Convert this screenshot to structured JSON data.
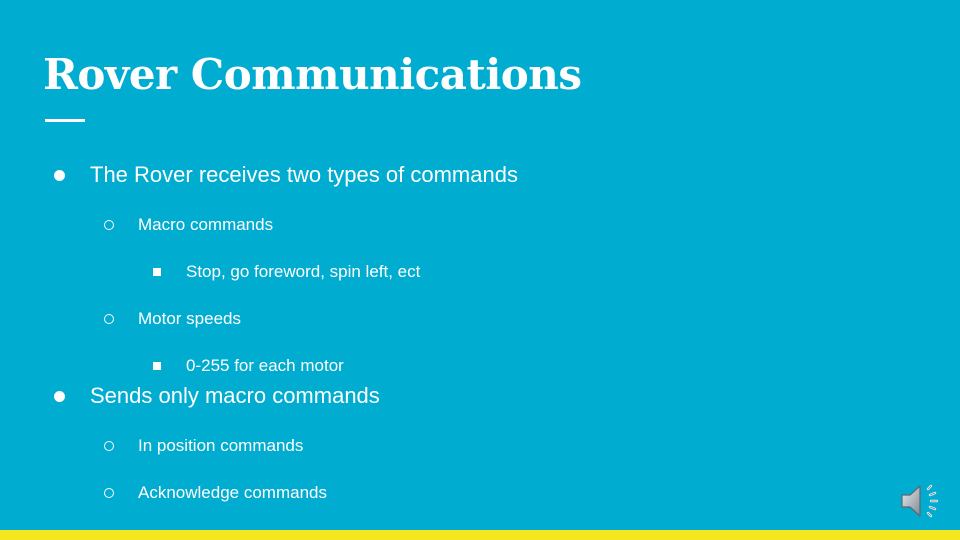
{
  "slide": {
    "title": "Rover Communications",
    "bullets": {
      "b1": "The Rover receives two types of commands",
      "b1_1": "Macro commands",
      "b1_1_1": "Stop, go foreword, spin left, ect",
      "b1_2": "Motor speeds",
      "b1_2_1": "0-255 for each motor",
      "b2": "Sends only macro commands",
      "b2_1": "In position commands",
      "b2_2": "Acknowledge commands"
    }
  },
  "colors": {
    "background": "#00acd0",
    "accent_bar": "#f5e71f",
    "text": "#ffffff"
  },
  "icons": {
    "audio": "speaker-icon"
  }
}
